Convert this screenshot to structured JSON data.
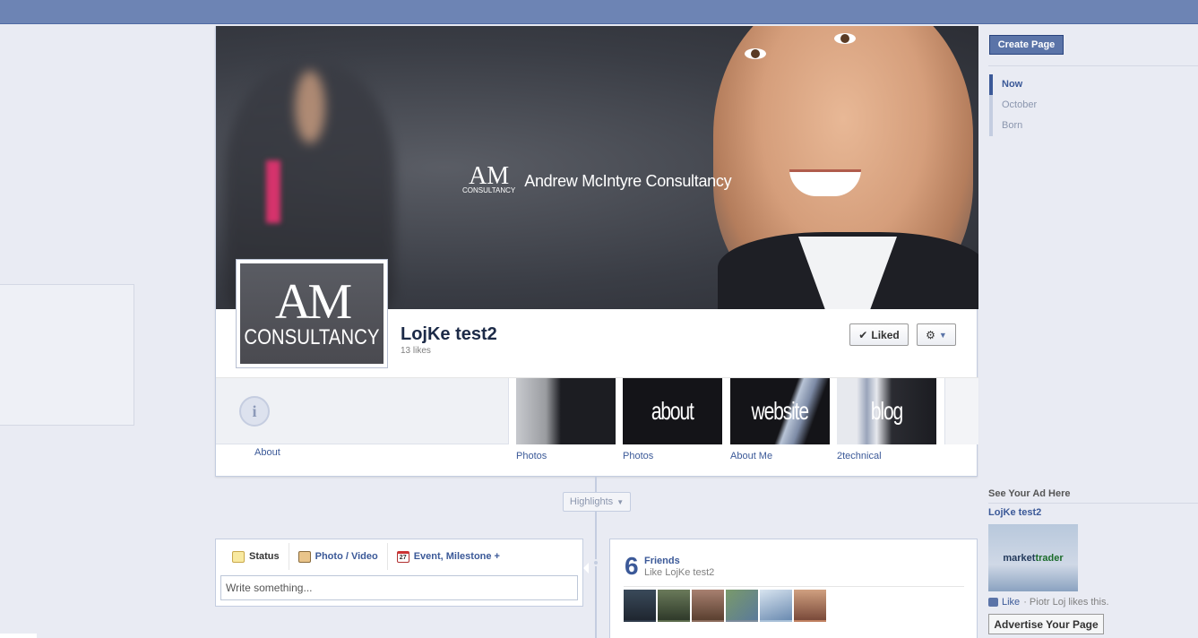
{
  "cover": {
    "brand_logo_top": "AM",
    "brand_logo_bottom": "CONSULTANCY",
    "brand_name": "Andrew McIntyre Consultancy"
  },
  "profile": {
    "logo_top": "AM",
    "logo_bottom": "CONSULTANCY",
    "name": "LojKe test2",
    "likes": "13 likes",
    "liked_label": "Liked",
    "gear_label": "⚙"
  },
  "apps": [
    {
      "label": "About"
    },
    {
      "label": "Photos",
      "thumb_text": ""
    },
    {
      "label": "Photos",
      "thumb_text": "about"
    },
    {
      "label": "About Me",
      "thumb_text": "website"
    },
    {
      "label": "2technical",
      "thumb_text": "blog"
    }
  ],
  "highlights": {
    "label": "Highlights"
  },
  "composer": {
    "tabs": [
      {
        "label": "Status"
      },
      {
        "label": "Photo / Video"
      },
      {
        "label": "Event, Milestone +"
      }
    ],
    "placeholder": "Write something..."
  },
  "friends": {
    "count": "6",
    "title": "Friends",
    "subtitle": "Like LojKe test2",
    "pic_colors": [
      "#2e3a4a",
      "#5a6a4a",
      "#8a6a5a",
      "#7a8a9a",
      "#a8c0d8",
      "#c08060"
    ]
  },
  "sidebar": {
    "create_page": "Create Page",
    "scrubber": [
      {
        "label": "Now",
        "active": true
      },
      {
        "label": "October",
        "active": false
      },
      {
        "label": "Born",
        "active": false
      }
    ]
  },
  "ad": {
    "heading": "See Your Ad Here",
    "title": "LojKe test2",
    "image_text_a": "market",
    "image_text_b": "trader",
    "like_link": "Like",
    "like_text": "· Piotr Loj likes this.",
    "advertise_button": "Advertise Your Page"
  }
}
